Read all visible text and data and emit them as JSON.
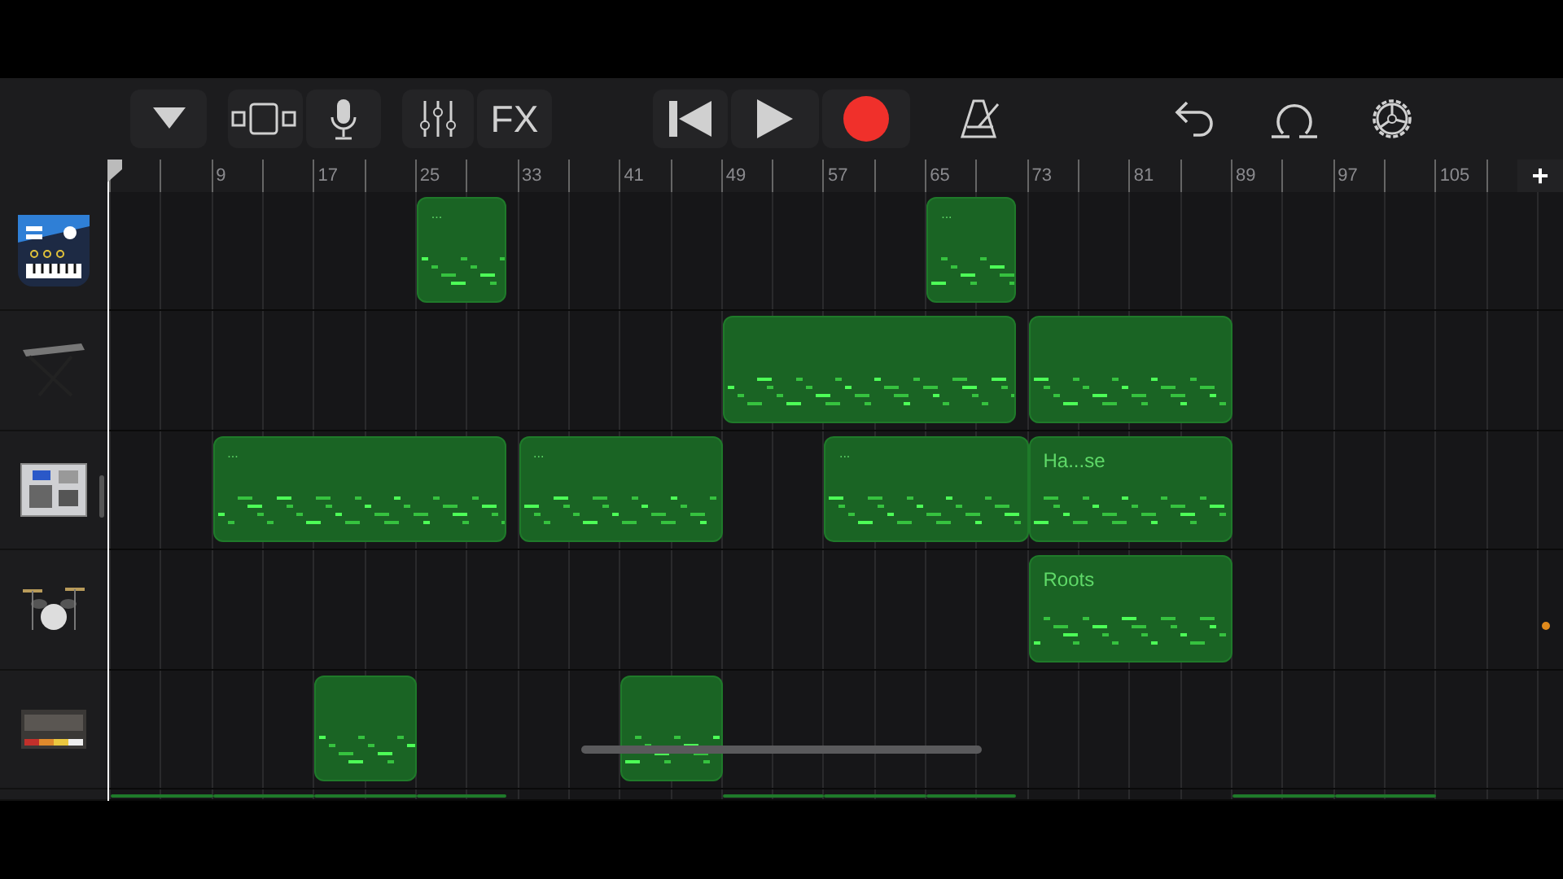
{
  "toolbar": {
    "fx_label": "FX"
  },
  "ruler": {
    "bars": [
      "9",
      "17",
      "25",
      "33",
      "41",
      "49",
      "57",
      "65",
      "73",
      "81",
      "89",
      "97",
      "105"
    ],
    "add_label": "+"
  },
  "tracks": [
    {
      "kind": "synth",
      "regions": [
        {
          "label": "..."
        },
        {
          "label": "..."
        }
      ]
    },
    {
      "kind": "keyboard"
    },
    {
      "kind": "drum-machine",
      "regions": [
        {
          "label": "..."
        },
        {
          "label": "..."
        },
        {
          "label": "..."
        },
        {
          "label": "Ha...se"
        }
      ]
    },
    {
      "kind": "drum-kit",
      "regions": [
        {
          "label": "Roots"
        }
      ]
    },
    {
      "kind": "beat-box"
    },
    {
      "kind": "partial"
    }
  ]
}
